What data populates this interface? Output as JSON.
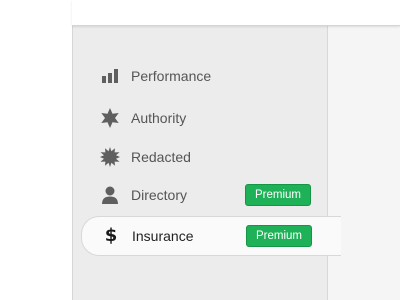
{
  "colors": {
    "sidebar_background": "#ececec",
    "active_background": "#fafafa",
    "badge_green": "#1fb157",
    "icon_gray": "#5f5f5f"
  },
  "sidebar": {
    "items": [
      {
        "label": "Performance",
        "icon": "bar-chart-icon",
        "active": false
      },
      {
        "label": "Authority",
        "icon": "sheriff-star-icon",
        "active": false
      },
      {
        "label": "Redacted",
        "icon": "starburst-seal-icon",
        "active": false
      },
      {
        "label": "Directory",
        "icon": "person-icon",
        "active": false,
        "badge": "Premium"
      },
      {
        "label": "Insurance",
        "icon": "dollar-icon",
        "active": true,
        "badge": "Premium"
      }
    ]
  }
}
